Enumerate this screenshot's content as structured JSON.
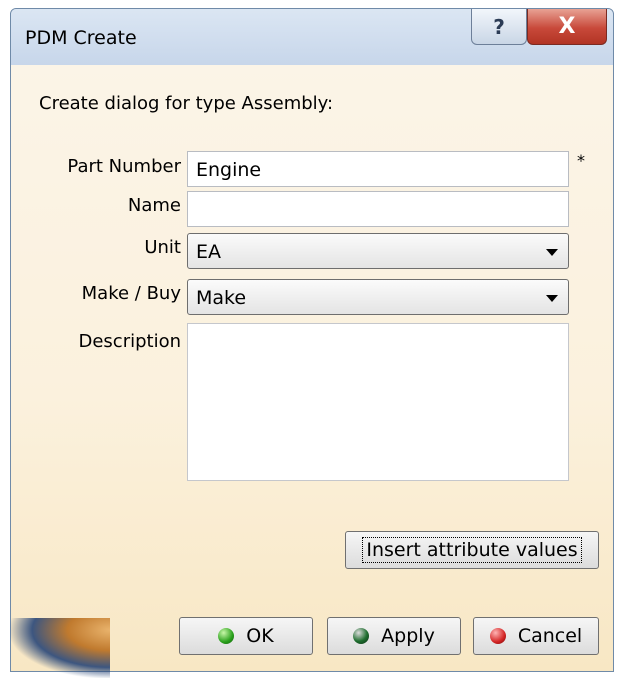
{
  "window": {
    "title": "PDM Create",
    "help_symbol": "?",
    "close_symbol": "X"
  },
  "dialog": {
    "heading": "Create dialog for type Assembly:",
    "required_marker": "*",
    "fields": {
      "part_number": {
        "label": "Part Number",
        "value": "Engine"
      },
      "name": {
        "label": "Name",
        "value": ""
      },
      "unit": {
        "label": "Unit",
        "value": "EA"
      },
      "make_buy": {
        "label": "Make / Buy",
        "value": "Make"
      },
      "description": {
        "label": "Description",
        "value": ""
      }
    },
    "insert_button": "Insert attribute values",
    "buttons": {
      "ok": "OK",
      "apply": "Apply",
      "cancel": "Cancel"
    }
  },
  "colors": {
    "title_bar": "#c7d6ea",
    "client_background": "#fbf1dd",
    "close_button": "#c8493a",
    "ok_dot": "#29a01b",
    "cancel_dot": "#d32424"
  }
}
